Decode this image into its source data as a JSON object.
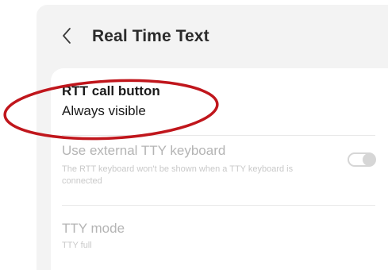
{
  "header": {
    "back_icon": "chevron-left-icon",
    "title": "Real Time Text"
  },
  "settings": {
    "rtt_call_button": {
      "title": "RTT call button",
      "subtitle": "Always visible"
    },
    "external_tty_keyboard": {
      "title": "Use external TTY keyboard",
      "subtitle": "The RTT keyboard won't be shown when a TTY keyboard is connected",
      "enabled": false,
      "toggle_on": false
    },
    "tty_mode": {
      "title": "TTY mode",
      "subtitle": "TTY full",
      "enabled": false
    }
  },
  "colors": {
    "annotation_ellipse": "#c0161c",
    "screen_background": "#f3f3f3",
    "card_background": "#ffffff",
    "disabled_text": "#b4b4b4"
  }
}
